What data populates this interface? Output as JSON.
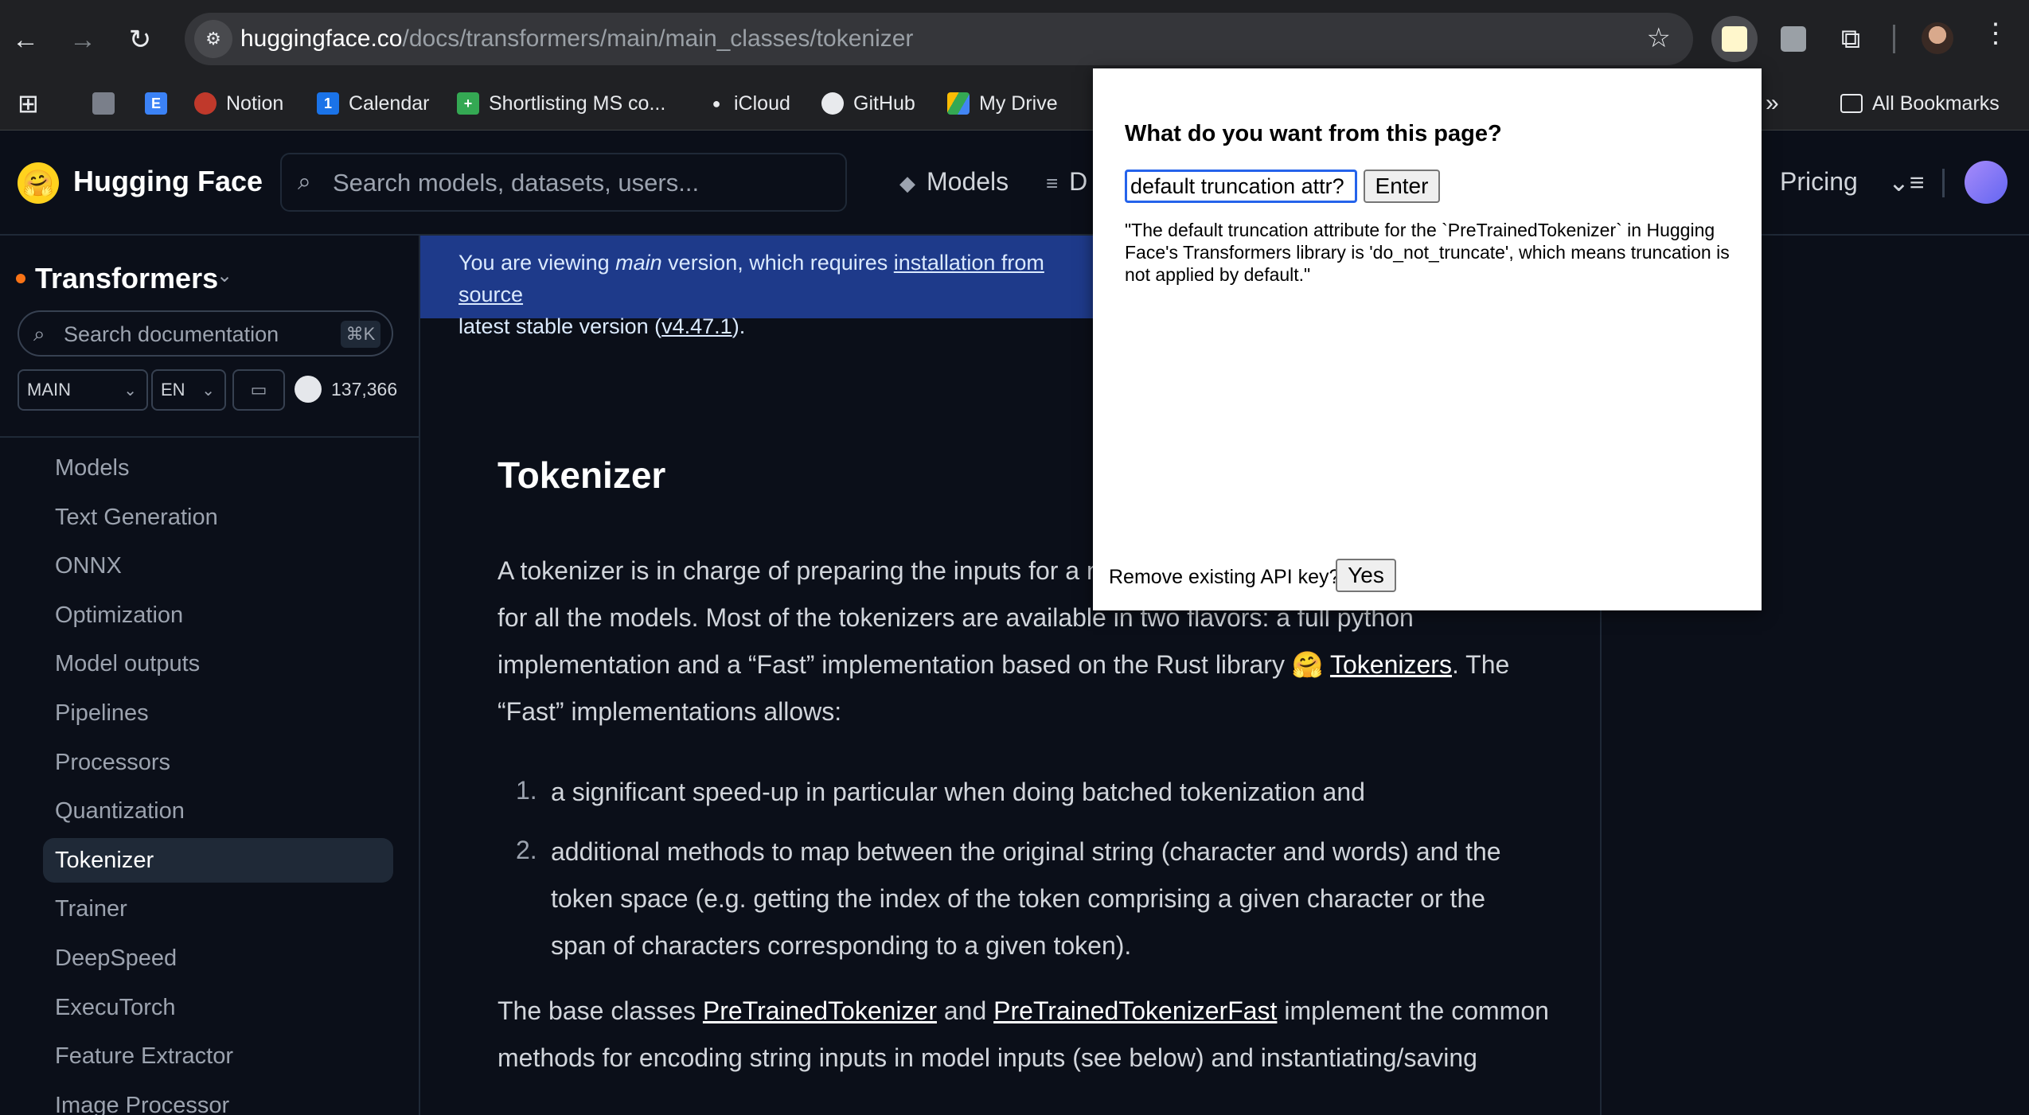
{
  "browser": {
    "url_host": "huggingface.co",
    "url_path": "/docs/transformers/main/main_classes/tokenizer",
    "bookmarks": [
      {
        "label": "Notion"
      },
      {
        "label": "Calendar"
      },
      {
        "label": "Shortlisting MS co..."
      },
      {
        "label": "iCloud"
      },
      {
        "label": "GitHub"
      },
      {
        "label": "My Drive"
      }
    ],
    "all_bookmarks": "All Bookmarks",
    "overflow": "»"
  },
  "hf_header": {
    "brand": "Hugging Face",
    "search_placeholder": "Search models, datasets, users...",
    "nav": {
      "models": "Models",
      "datasets": "D",
      "pricing": "Pricing"
    }
  },
  "sidebar": {
    "title": "Transformers",
    "search_placeholder": "Search documentation",
    "shortcut": "⌘K",
    "version": "MAIN",
    "language": "EN",
    "github_stars": "137,366",
    "items": [
      {
        "label": "Models"
      },
      {
        "label": "Text Generation"
      },
      {
        "label": "ONNX"
      },
      {
        "label": "Optimization"
      },
      {
        "label": "Model outputs"
      },
      {
        "label": "Pipelines"
      },
      {
        "label": "Processors"
      },
      {
        "label": "Quantization"
      },
      {
        "label": "Tokenizer",
        "active": true
      },
      {
        "label": "Trainer"
      },
      {
        "label": "DeepSpeed"
      },
      {
        "label": "ExecuTorch"
      },
      {
        "label": "Feature Extractor"
      },
      {
        "label": "Image Processor"
      }
    ]
  },
  "banner": {
    "prefix": "You are viewing ",
    "version": "main",
    "middle": " version, which requires ",
    "link": "installation from source",
    "line2_prefix": "latest stable version (",
    "stable_link": "v4.47.1",
    "line2_suffix": ")."
  },
  "main": {
    "title": "Tokenizer",
    "intro_l1": "A tokenizer is in charge of preparing the inputs for a m",
    "intro_l2": "for all the models. Most of the tokenizers are available in two flavors: a full python",
    "intro_l3_prefix": "implementation and a “Fast” implementation based on the Rust library 🤗 ",
    "intro_l3_link": "Tokenizers",
    "intro_l3_suffix": ". The",
    "intro_l4": "“Fast” implementations allows:",
    "list": [
      {
        "num": "1.",
        "lines": [
          "a significant speed-up in particular when doing batched tokenization and"
        ]
      },
      {
        "num": "2.",
        "lines": [
          "additional methods to map between the original string (character and words) and the",
          "token space (e.g. getting the index of the token comprising a given character or the",
          "span of characters corresponding to a given token)."
        ]
      }
    ],
    "base_prefix": "The base classes ",
    "base_link1": "PreTrainedTokenizer",
    "base_and": " and ",
    "base_link2": "PreTrainedTokenizerFast",
    "base_suffix": " implement the common",
    "base_l2": "methods for encoding string inputs in model inputs (see below) and instantiating/saving"
  },
  "popup": {
    "question": "What do you want from this page?",
    "query": "default truncation attr?",
    "enter_label": "Enter",
    "answer": "\"The default truncation attribute for the `PreTrainedTokenizer` in Hugging Face's Transformers library is 'do_not_truncate', which means truncation is not applied by default.\"",
    "remove_label": "Remove existing API key?",
    "yes_label": "Yes"
  }
}
